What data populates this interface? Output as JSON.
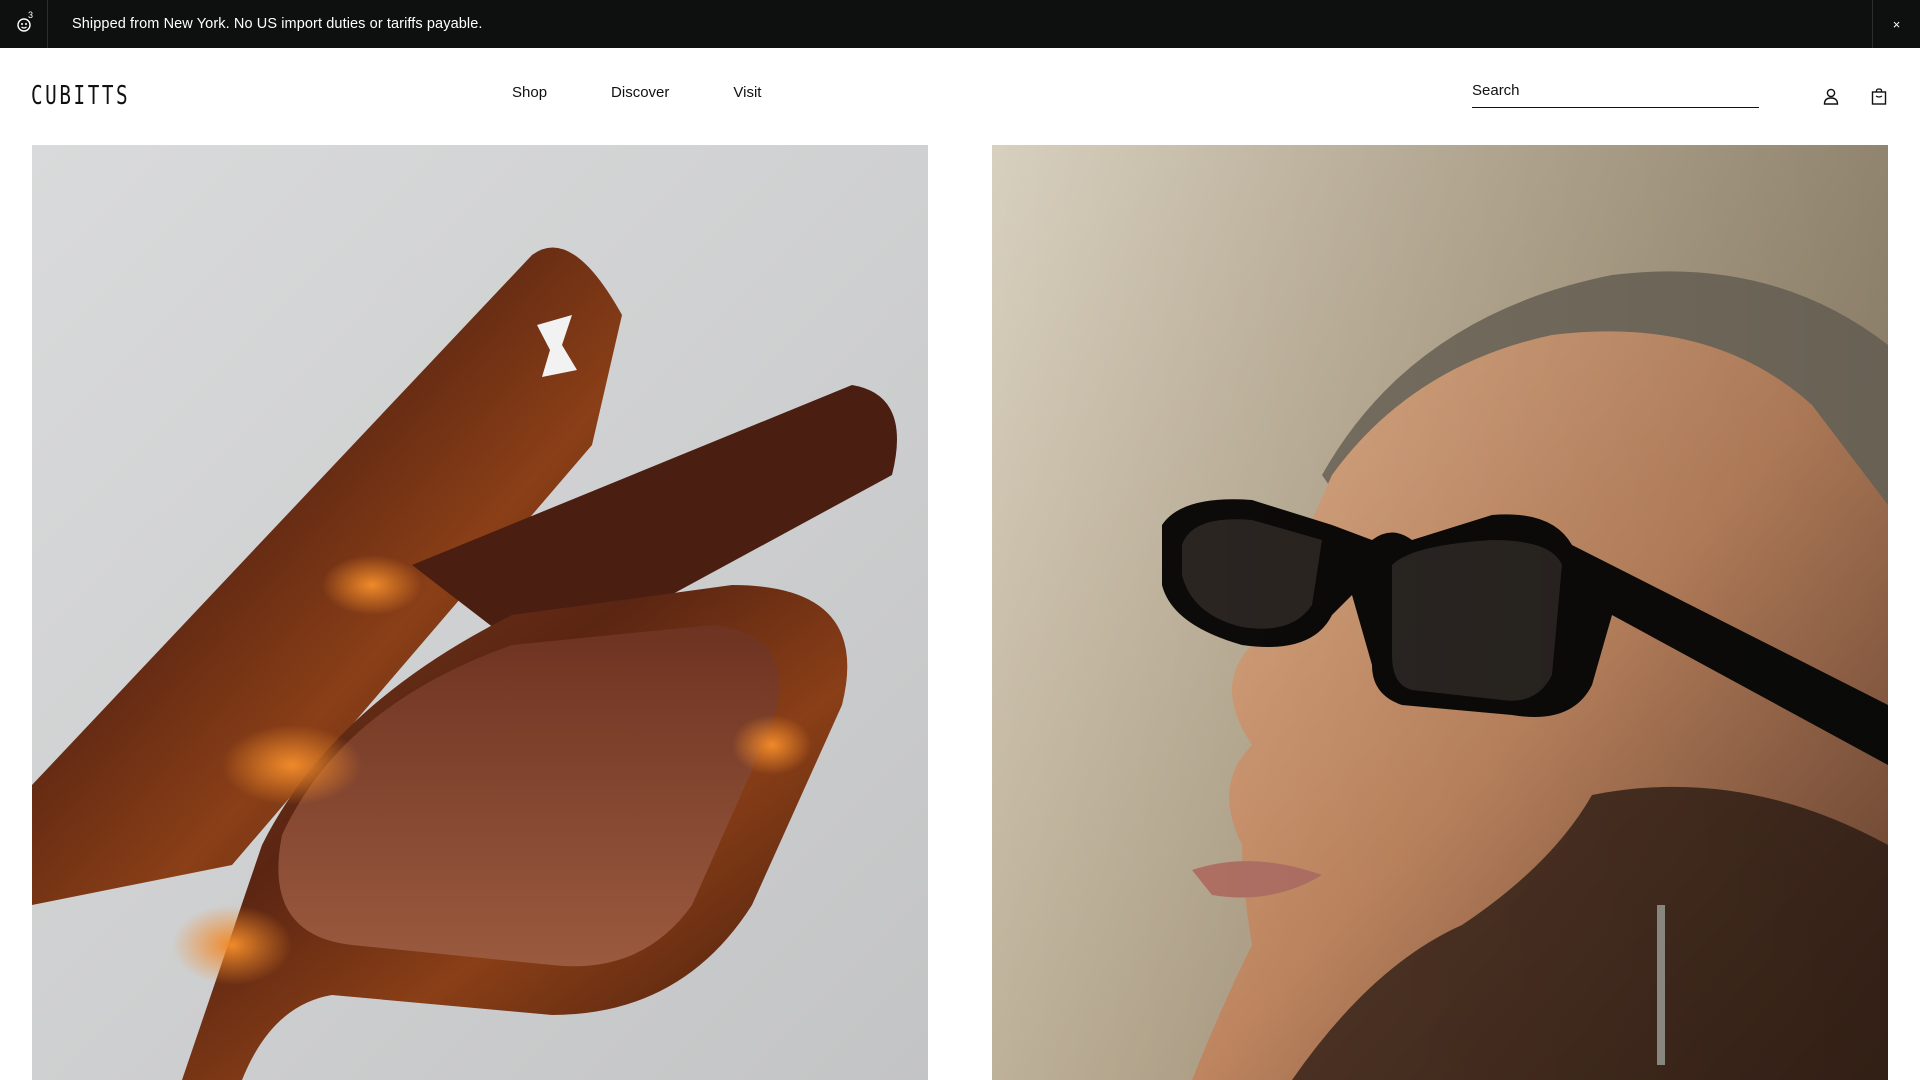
{
  "announcement": {
    "accessibility_badge": "3",
    "message": "Shipped from New York. No US import duties or tariffs payable.",
    "close_label": "×"
  },
  "header": {
    "logo": "CUBITTS",
    "nav": [
      {
        "label": "Shop"
      },
      {
        "label": "Discover"
      },
      {
        "label": "Visit"
      }
    ],
    "search_placeholder": "Search",
    "icons": [
      "account-icon",
      "bag-icon"
    ]
  },
  "hero": {
    "left_image": "tortoiseshell-sunglasses-closeup",
    "right_image": "woman-wearing-black-sunglasses-portrait"
  },
  "colors": {
    "announcement_bg": "#0e0f0f",
    "text": "#111111",
    "background": "#ffffff"
  }
}
